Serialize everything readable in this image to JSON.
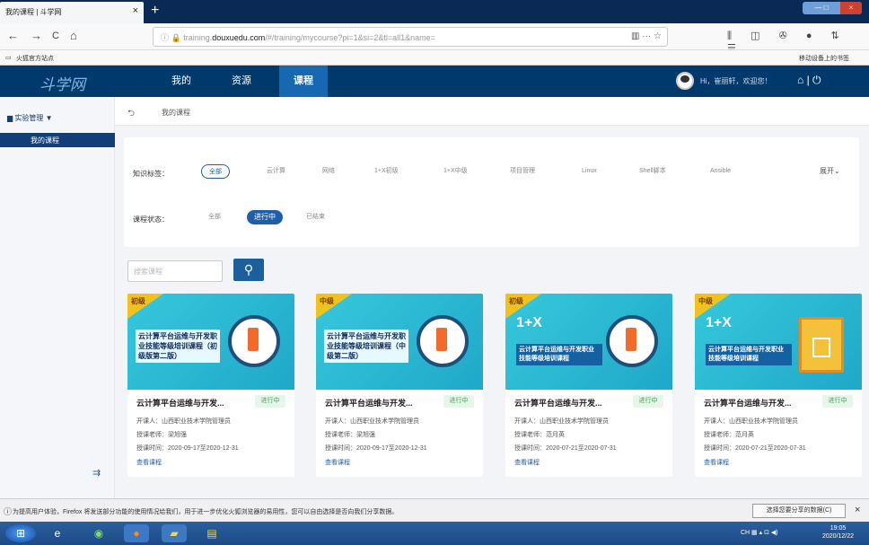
{
  "browser": {
    "tab_title": "我的课程 | 斗学网",
    "tab_close": "×",
    "new_tab": "+",
    "window_controls": "— □ ×",
    "nav": {
      "back": "←",
      "forward": "→",
      "reload": "C",
      "home": "⌂"
    },
    "url_prefix": "training.",
    "url_domain": "douxuedu.com",
    "url_path": "/#/training/mycourse?pi=1&si=2&tl=all1&name=",
    "url_icons": "▥ ··· ☆",
    "toolbar_icons": "⫼ ◫ ✇ ● ⇅ ☰",
    "bookmark_left": "火狐官方站点",
    "bookmark_right": "移动设备上的书签"
  },
  "site": {
    "logo": "斗学网",
    "nav": [
      "我的",
      "资源",
      "课程"
    ],
    "greeting": "Hi，崔丽轩，欢迎您！",
    "header_icons": "⌂ | ⏻"
  },
  "sidebar": {
    "group": "实验管理 ▼",
    "item": "我的课程",
    "collapse_icon": "⇉"
  },
  "breadcrumb": {
    "back": "⮌",
    "label": "我的课程"
  },
  "filters": {
    "knowledge_label": "知识标签：",
    "knowledge_tags": [
      "全部",
      "云计算",
      "网络",
      "1+X初级",
      "1+X中级",
      "项目管理",
      "Linux",
      "Shell脚本",
      "Ansible"
    ],
    "expand": "展开⌄",
    "status_label": "课程状态：",
    "status_tags": [
      "全部",
      "进行中",
      "已结束"
    ]
  },
  "search": {
    "placeholder": "搜索课程",
    "button": "⚲"
  },
  "cards": [
    {
      "level": "初级",
      "banner_title": "云计算平台运维与开发职业技能等级培训课程（初级版第二版）",
      "title": "云计算平台运维与开发...",
      "status": "进行中",
      "creator": "开课人：山西职业技术学院管理员",
      "teacher": "授课老师：梁旭强",
      "period": "授课时间：2020-09-17至2020-12-31",
      "link": "查看课程"
    },
    {
      "level": "中级",
      "banner_title": "云计算平台运维与开发职业技能等级培训课程（中级第二版）",
      "title": "云计算平台运维与开发...",
      "status": "进行中",
      "creator": "开课人：山西职业技术学院管理员",
      "teacher": "授课老师：梁旭强",
      "period": "授课时间：2020-09-17至2020-12-31",
      "link": "查看课程"
    },
    {
      "level": "初级",
      "onex": "1+X",
      "banner_sub": "云计算平台运维与开发职业技能等级培训课程",
      "title": "云计算平台运维与开发...",
      "status": "进行中",
      "creator": "开课人：山西职业技术学院管理员",
      "teacher": "授课老师：范月英",
      "period": "授课时间：2020-07-21至2020-07-31",
      "link": "查看课程"
    },
    {
      "level": "中级",
      "onex": "1+X",
      "banner_sub": "云计算平台运维与开发职业技能等级培训课程",
      "title": "云计算平台运维与开发...",
      "status": "进行中",
      "creator": "开课人：山西职业技术学院管理员",
      "teacher": "授课老师：范月英",
      "period": "授课时间：2020-07-21至2020-07-31",
      "link": "查看课程"
    }
  ],
  "notification": {
    "icon": "ⓘ",
    "text": "为提高用户体验，Firefox 将发送部分功能的使用情况给我们，用于进一步优化火狐浏览器的易用性，您可以自由选择是否向我们分享数据。",
    "button": "选择您要分享的数据(C)",
    "close": "×"
  },
  "taskbar": {
    "tray": "CH ▦ ▴ ⊡ ◀)",
    "time": "19:05",
    "date": "2020/12/22"
  }
}
